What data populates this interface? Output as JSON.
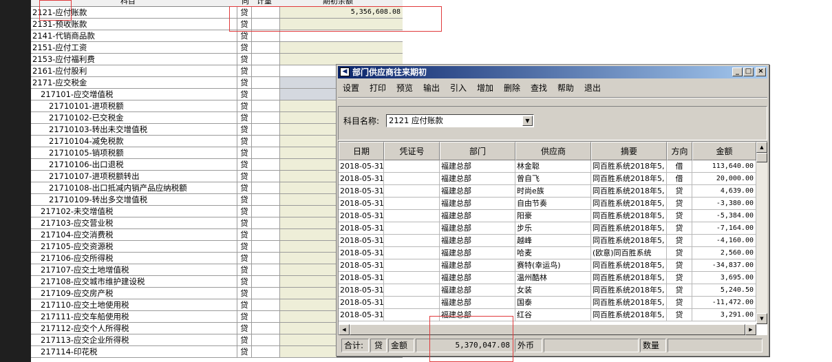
{
  "background_grid": {
    "header": {
      "subject": "科目",
      "direction": "向",
      "unit": "计量",
      "balance": "期初余额"
    },
    "rows": [
      {
        "name": "2121-应付账款",
        "dir": "贷",
        "balance": "5,356,608.08",
        "indent": 0,
        "style": "cream"
      },
      {
        "name": "2131-预收账款",
        "dir": "贷",
        "balance": "",
        "indent": 0,
        "style": "cream"
      },
      {
        "name": "2141-代销商品款",
        "dir": "贷",
        "balance": "",
        "indent": 0,
        "style": "white"
      },
      {
        "name": "2151-应付工资",
        "dir": "贷",
        "balance": "",
        "indent": 0,
        "style": "cream"
      },
      {
        "name": "2153-应付福利费",
        "dir": "贷",
        "balance": "",
        "indent": 0,
        "style": "cream"
      },
      {
        "name": "2161-应付股利",
        "dir": "贷",
        "balance": "",
        "indent": 0,
        "style": "white"
      },
      {
        "name": "2171-应交税金",
        "dir": "贷",
        "balance": "",
        "indent": 0,
        "style": "grey"
      },
      {
        "name": "217101-应交增值税",
        "dir": "贷",
        "balance": "",
        "indent": 1,
        "style": "grey"
      },
      {
        "name": "21710101-进项税额",
        "dir": "贷",
        "balance": "",
        "indent": 2,
        "style": "cream"
      },
      {
        "name": "21710102-已交税金",
        "dir": "贷",
        "balance": "",
        "indent": 2,
        "style": "cream"
      },
      {
        "name": "21710103-转出未交增值税",
        "dir": "贷",
        "balance": "",
        "indent": 2,
        "style": "cream"
      },
      {
        "name": "21710104-减免税款",
        "dir": "贷",
        "balance": "",
        "indent": 2,
        "style": "cream"
      },
      {
        "name": "21710105-销项税额",
        "dir": "贷",
        "balance": "",
        "indent": 2,
        "style": "cream"
      },
      {
        "name": "21710106-出口退税",
        "dir": "贷",
        "balance": "",
        "indent": 2,
        "style": "cream"
      },
      {
        "name": "21710107-进项税额转出",
        "dir": "贷",
        "balance": "",
        "indent": 2,
        "style": "cream"
      },
      {
        "name": "21710108-出口抵减内销产品应纳税额",
        "dir": "贷",
        "balance": "",
        "indent": 2,
        "style": "cream"
      },
      {
        "name": "21710109-转出多交增值税",
        "dir": "贷",
        "balance": "",
        "indent": 2,
        "style": "cream"
      },
      {
        "name": "217102-未交增值税",
        "dir": "贷",
        "balance": "",
        "indent": 1,
        "style": "cream"
      },
      {
        "name": "217103-应交营业税",
        "dir": "贷",
        "balance": "",
        "indent": 1,
        "style": "cream"
      },
      {
        "name": "217104-应交消费税",
        "dir": "贷",
        "balance": "",
        "indent": 1,
        "style": "cream"
      },
      {
        "name": "217105-应交资源税",
        "dir": "贷",
        "balance": "",
        "indent": 1,
        "style": "cream"
      },
      {
        "name": "217106-应交所得税",
        "dir": "贷",
        "balance": "",
        "indent": 1,
        "style": "cream"
      },
      {
        "name": "217107-应交土地增值税",
        "dir": "贷",
        "balance": "",
        "indent": 1,
        "style": "cream"
      },
      {
        "name": "217108-应交城市维护建设税",
        "dir": "贷",
        "balance": "",
        "indent": 1,
        "style": "cream"
      },
      {
        "name": "217109-应交房产税",
        "dir": "贷",
        "balance": "",
        "indent": 1,
        "style": "cream"
      },
      {
        "name": "217110-应交土地使用税",
        "dir": "贷",
        "balance": "",
        "indent": 1,
        "style": "cream"
      },
      {
        "name": "217111-应交车船使用税",
        "dir": "贷",
        "balance": "",
        "indent": 1,
        "style": "cream"
      },
      {
        "name": "217112-应交个人所得税",
        "dir": "贷",
        "balance": "",
        "indent": 1,
        "style": "cream"
      },
      {
        "name": "217113-应交企业所得税",
        "dir": "贷",
        "balance": "",
        "indent": 1,
        "style": "cream"
      },
      {
        "name": "217114-印花税",
        "dir": "贷",
        "balance": "",
        "indent": 1,
        "style": "cream"
      }
    ]
  },
  "dialog": {
    "title": "部门供应商往来期初",
    "title_icon": "◀",
    "window_buttons": {
      "minimize": "_",
      "maximize": "□",
      "close": "×"
    },
    "menu": [
      "设置",
      "打印",
      "预览",
      "输出",
      "引入",
      "增加",
      "删除",
      "查找",
      "帮助",
      "退出"
    ],
    "subject_label": "科目名称:",
    "subject_value": "2121 应付账款",
    "columns": [
      "日期",
      "凭证号",
      "部门",
      "供应商",
      "摘要",
      "方向",
      "金额"
    ],
    "rows": [
      {
        "date": "2018-05-31",
        "voucher": "",
        "dept": "福建总部",
        "supplier": "林金聪",
        "summary": "同百胜系统2018年5,",
        "dir": "借",
        "amount": "113,640.00"
      },
      {
        "date": "2018-05-31",
        "voucher": "",
        "dept": "福建总部",
        "supplier": "曾自飞",
        "summary": "同百胜系统2018年5,",
        "dir": "借",
        "amount": "20,000.00"
      },
      {
        "date": "2018-05-31",
        "voucher": "",
        "dept": "福建总部",
        "supplier": "时尚e族",
        "summary": "同百胜系统2018年5,",
        "dir": "贷",
        "amount": "4,639.00"
      },
      {
        "date": "2018-05-31",
        "voucher": "",
        "dept": "福建总部",
        "supplier": "自由节奏",
        "summary": "同百胜系统2018年5,",
        "dir": "贷",
        "amount": "-3,380.00"
      },
      {
        "date": "2018-05-31",
        "voucher": "",
        "dept": "福建总部",
        "supplier": "阳豪",
        "summary": "同百胜系统2018年5,",
        "dir": "贷",
        "amount": "-5,384.00"
      },
      {
        "date": "2018-05-31",
        "voucher": "",
        "dept": "福建总部",
        "supplier": "步乐",
        "summary": "同百胜系统2018年5,",
        "dir": "贷",
        "amount": "-7,164.00"
      },
      {
        "date": "2018-05-31",
        "voucher": "",
        "dept": "福建总部",
        "supplier": "越峰",
        "summary": "同百胜系统2018年5,",
        "dir": "贷",
        "amount": "-4,160.00"
      },
      {
        "date": "2018-05-31",
        "voucher": "",
        "dept": "福建总部",
        "supplier": "哈麦",
        "summary": "(欧意)同百胜系统",
        "dir": "贷",
        "amount": "2,560.00"
      },
      {
        "date": "2018-05-31",
        "voucher": "",
        "dept": "福建总部",
        "supplier": "赛特(幸运鸟)",
        "summary": "同百胜系统2018年5,",
        "dir": "贷",
        "amount": "-34,837.00"
      },
      {
        "date": "2018-05-31",
        "voucher": "",
        "dept": "福建总部",
        "supplier": "温州酷林",
        "summary": "同百胜系统2018年5,",
        "dir": "贷",
        "amount": "3,695.00"
      },
      {
        "date": "2018-05-31",
        "voucher": "",
        "dept": "福建总部",
        "supplier": "女装",
        "summary": "同百胜系统2018年5,",
        "dir": "贷",
        "amount": "5,240.50"
      },
      {
        "date": "2018-05-31",
        "voucher": "",
        "dept": "福建总部",
        "supplier": "国泰",
        "summary": "同百胜系统2018年5,",
        "dir": "贷",
        "amount": "-11,472.00"
      },
      {
        "date": "2018-05-31",
        "voucher": "",
        "dept": "福建总部",
        "supplier": "红谷",
        "summary": "同百胜系统2018年5,",
        "dir": "贷",
        "amount": "3,291.00"
      }
    ],
    "totals": {
      "label": "合计:",
      "dir": "贷",
      "amount_label": "金额",
      "amount": "5,370,047.08",
      "fx_label": "外币",
      "fx_value": "",
      "qty_label": "数量",
      "qty_value": ""
    },
    "scroll_arrows": {
      "up": "▲",
      "down": "▼",
      "left": "◀",
      "right": "▶"
    }
  },
  "colors": {
    "annotation_red": "#e0393b",
    "title_bar_start": "#0a246a",
    "cream_cell": "#eeeed8"
  }
}
